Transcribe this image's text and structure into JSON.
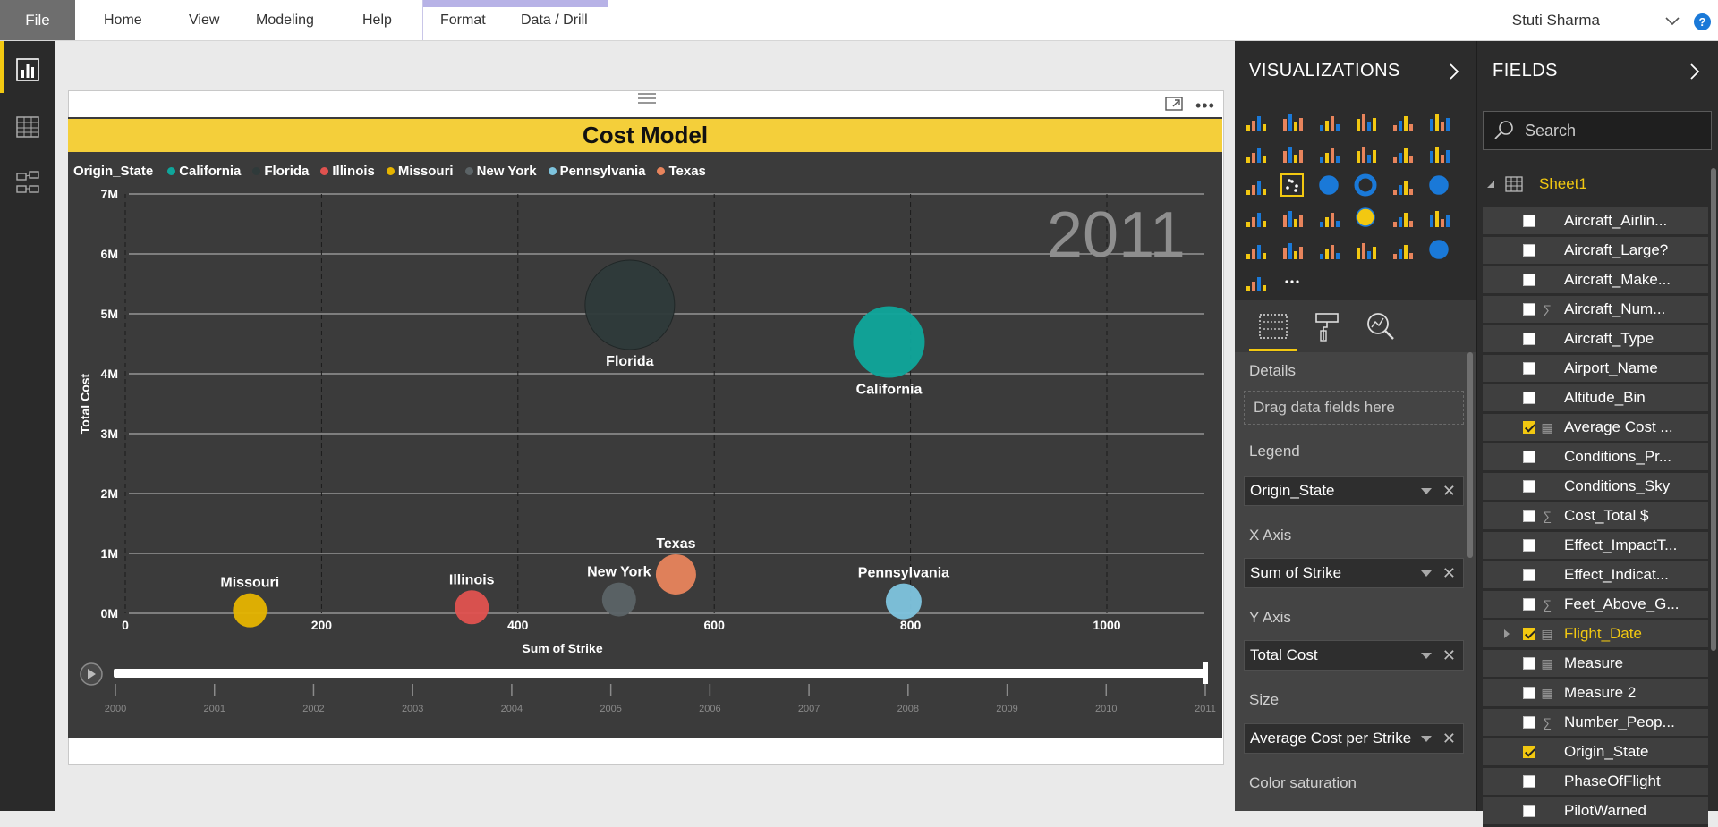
{
  "ribbon": {
    "file": "File",
    "tabs": [
      "Home",
      "View",
      "Modeling",
      "Help"
    ],
    "context_tabs": [
      "Format",
      "Data / Drill"
    ],
    "user": "Stuti Sharma"
  },
  "visual": {
    "title": "Cost Model",
    "legend_title": "Origin_State",
    "legend": [
      {
        "name": "California",
        "color": "#0fa69b"
      },
      {
        "name": "Florida",
        "color": "#2f3a3a"
      },
      {
        "name": "Illinois",
        "color": "#e0524f"
      },
      {
        "name": "Missouri",
        "color": "#e6b400"
      },
      {
        "name": "New York",
        "color": "#5b6366"
      },
      {
        "name": "Pennsylvania",
        "color": "#7ec4de"
      },
      {
        "name": "Texas",
        "color": "#e8845c"
      }
    ],
    "year_watermark": "2011",
    "play_axis_years": [
      "2000",
      "2001",
      "2002",
      "2003",
      "2004",
      "2005",
      "2006",
      "2007",
      "2008",
      "2009",
      "2010",
      "2011"
    ],
    "play_axis_value": "2011"
  },
  "chart_data": {
    "type": "scatter",
    "title": "Cost Model",
    "xlabel": "Sum of Strike",
    "ylabel": "Total Cost",
    "xlim": [
      0,
      1100
    ],
    "ylim": [
      0,
      7000000
    ],
    "x_ticks": [
      0,
      200,
      400,
      600,
      800,
      1000
    ],
    "x_tick_labels": [
      "0",
      "200",
      "400",
      "600",
      "800",
      "1000"
    ],
    "y_ticks": [
      0,
      1000000,
      2000000,
      3000000,
      4000000,
      5000000,
      6000000,
      7000000
    ],
    "y_tick_labels": [
      "0M",
      "1M",
      "2M",
      "3M",
      "4M",
      "5M",
      "6M",
      "7M"
    ],
    "grid": true,
    "legend_position": "top-left",
    "series": [
      {
        "name": "Missouri",
        "x": 127,
        "y": 50000,
        "size": 0.38,
        "color": "#e6b400"
      },
      {
        "name": "Illinois",
        "x": 353,
        "y": 100000,
        "size": 0.38,
        "color": "#e0524f"
      },
      {
        "name": "New York",
        "x": 503,
        "y": 230000,
        "size": 0.38,
        "color": "#5b6366"
      },
      {
        "name": "Texas",
        "x": 561,
        "y": 650000,
        "size": 0.45,
        "color": "#e8845c"
      },
      {
        "name": "Florida",
        "x": 514,
        "y": 5150000,
        "size": 1.0,
        "color": "#2f3a3a"
      },
      {
        "name": "California",
        "x": 778,
        "y": 4530000,
        "size": 0.8,
        "color": "#0fa69b"
      },
      {
        "name": "Pennsylvania",
        "x": 793,
        "y": 200000,
        "size": 0.4,
        "color": "#7ec4de"
      }
    ]
  },
  "visualizations": {
    "title": "VISUALIZATIONS",
    "wells": {
      "details_label": "Details",
      "details_placeholder": "Drag data fields here",
      "legend_label": "Legend",
      "legend_value": "Origin_State",
      "xaxis_label": "X Axis",
      "xaxis_value": "Sum of Strike",
      "yaxis_label": "Y Axis",
      "yaxis_value": "Total Cost",
      "size_label": "Size",
      "size_value": "Average Cost per Strike",
      "color_saturation_label": "Color saturation"
    }
  },
  "fields": {
    "title": "FIELDS",
    "search_placeholder": "Search",
    "table": "Sheet1",
    "items": [
      {
        "name": "Aircraft_Airlin...",
        "icon": "",
        "checked": false
      },
      {
        "name": "Aircraft_Large?",
        "icon": "",
        "checked": false
      },
      {
        "name": "Aircraft_Make...",
        "icon": "",
        "checked": false
      },
      {
        "name": "Aircraft_Num...",
        "icon": "sigma",
        "checked": false
      },
      {
        "name": "Aircraft_Type",
        "icon": "",
        "checked": false
      },
      {
        "name": "Airport_Name",
        "icon": "",
        "checked": false
      },
      {
        "name": "Altitude_Bin",
        "icon": "",
        "checked": false
      },
      {
        "name": "Average Cost ...",
        "icon": "calc",
        "checked": true
      },
      {
        "name": "Conditions_Pr...",
        "icon": "",
        "checked": false
      },
      {
        "name": "Conditions_Sky",
        "icon": "",
        "checked": false
      },
      {
        "name": "Cost_Total $",
        "icon": "sigma",
        "checked": false
      },
      {
        "name": "Effect_ImpactT...",
        "icon": "",
        "checked": false
      },
      {
        "name": "Effect_Indicat...",
        "icon": "",
        "checked": false
      },
      {
        "name": "Feet_Above_G...",
        "icon": "sigma",
        "checked": false
      },
      {
        "name": "Flight_Date",
        "icon": "table",
        "checked": true,
        "date": true
      },
      {
        "name": "Measure",
        "icon": "calc",
        "checked": false
      },
      {
        "name": "Measure 2",
        "icon": "calc",
        "checked": false
      },
      {
        "name": "Number_Peop...",
        "icon": "sigma",
        "checked": false
      },
      {
        "name": "Origin_State",
        "icon": "",
        "checked": true
      },
      {
        "name": "PhaseOfFlight",
        "icon": "",
        "checked": false
      },
      {
        "name": "PilotWarned",
        "icon": "",
        "checked": false
      }
    ]
  }
}
